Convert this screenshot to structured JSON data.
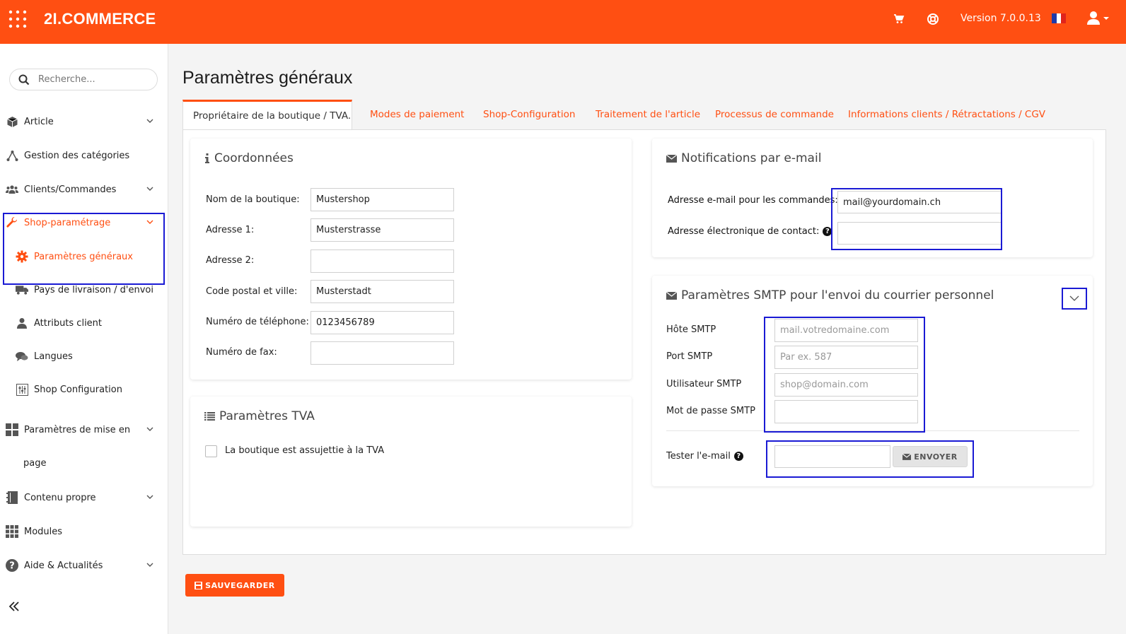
{
  "header": {
    "brand": "2I.COMMERCE",
    "version": "Version 7.0.0.13",
    "icons": [
      "apps-grid-icon",
      "cart-icon",
      "help-globe-icon",
      "flag-fr-icon",
      "user-icon"
    ],
    "bg_color": "#ff4f12"
  },
  "sidebar": {
    "search_placeholder": "Recherche...",
    "items": [
      {
        "label": "Article",
        "icon": "box-icon"
      },
      {
        "label": "Gestion des catégories",
        "icon": "tree-icon"
      },
      {
        "label": "Clients/Commandes",
        "icon": "users-icon"
      },
      {
        "label": "Shop-paramétrage",
        "icon": "wrench-icon"
      },
      {
        "label": "Paramètres généraux",
        "icon": "gear-icon"
      },
      {
        "label": "Pays de livraison / d'envoi",
        "icon": "truck-icon"
      },
      {
        "label": "Attributs client",
        "icon": "user-icon"
      },
      {
        "label": "Langues",
        "icon": "chat-icon"
      },
      {
        "label": "Shop Configuration",
        "icon": "config-icon"
      },
      {
        "label": "Paramètres de mise en",
        "label2": "page",
        "icon": "layout-icon"
      },
      {
        "label": "Contenu propre",
        "icon": "notebook-icon"
      },
      {
        "label": "Modules",
        "icon": "modules-icon"
      },
      {
        "label": "Aide & Actualités",
        "icon": "question-icon"
      }
    ]
  },
  "page": {
    "title": "Paramètres généraux",
    "tabs": [
      "Propriétaire de la boutique / TVA.",
      "Modes de paiement",
      "Shop-Configuration",
      "Traitement de l'article",
      "Processus de commande",
      "Informations clients / Rétractations / CGV"
    ],
    "save_label": "SAUVEGARDER"
  },
  "coordonnees": {
    "title": "Coordonnées",
    "fields": [
      {
        "label": "Nom de la boutique:",
        "value": "Mustershop"
      },
      {
        "label": "Adresse 1:",
        "value": "Musterstrasse"
      },
      {
        "label": "Adresse 2:",
        "value": ""
      },
      {
        "label": "Code postal et ville:",
        "value": "Musterstadt"
      },
      {
        "label": "Numéro de téléphone:",
        "value": "0123456789"
      },
      {
        "label": "Numéro de fax:",
        "value": ""
      }
    ]
  },
  "tva": {
    "title": "Paramètres TVA",
    "checkbox_label": "La boutique est assujettie à la TVA"
  },
  "notifications": {
    "title": "Notifications par e-mail",
    "order_email_label": "Adresse e-mail pour les commandes:",
    "order_email_value": "mail@yourdomain.ch",
    "contact_email_label": "Adresse électronique de contact:",
    "contact_email_value": ""
  },
  "smtp": {
    "title": "Paramètres SMTP pour l'envoi du courrier personnel",
    "host_label": "Hôte SMTP",
    "host_placeholder": "mail.votredomaine.com",
    "port_label": "Port SMTP",
    "port_placeholder": "Par ex. 587",
    "user_label": "Utilisateur SMTP",
    "user_placeholder": "shop@domain.com",
    "password_label": "Mot de passe SMTP",
    "test_label": "Tester l'e-mail",
    "send_label": "ENVOYER"
  }
}
